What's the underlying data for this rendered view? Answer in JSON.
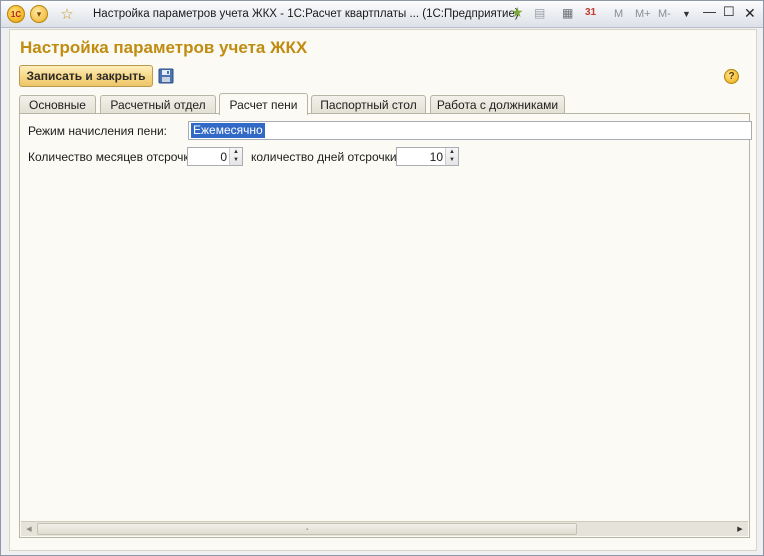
{
  "window": {
    "title": "Настройка параметров учета ЖКХ - 1С:Расчет квартплаты ...  (1С:Предприятие)",
    "logo_text": "1С",
    "toolbar": {
      "m": "M",
      "m_plus": "M+",
      "m_minus": "M-",
      "calendar_day": "31"
    }
  },
  "form": {
    "title": "Настройка параметров учета ЖКХ",
    "save_close_label": "Записать и закрыть",
    "help_label": "?"
  },
  "tabs": [
    {
      "label": "Основные"
    },
    {
      "label": "Расчетный отдел"
    },
    {
      "label": "Расчет пени"
    },
    {
      "label": "Паспортный стол"
    },
    {
      "label": "Работа с должниками"
    }
  ],
  "active_tab": "Расчет пени",
  "penalty": {
    "mode_label": "Режим начисления пени:",
    "mode_value": "Ежемесячно",
    "months_label": "Количество месяцев отсрочки:",
    "months_value": "0",
    "days_label": "количество дней отсрочки:",
    "days_value": "10"
  },
  "colors": {
    "title_accent": "#c08c11",
    "selection": "#3169c6"
  }
}
